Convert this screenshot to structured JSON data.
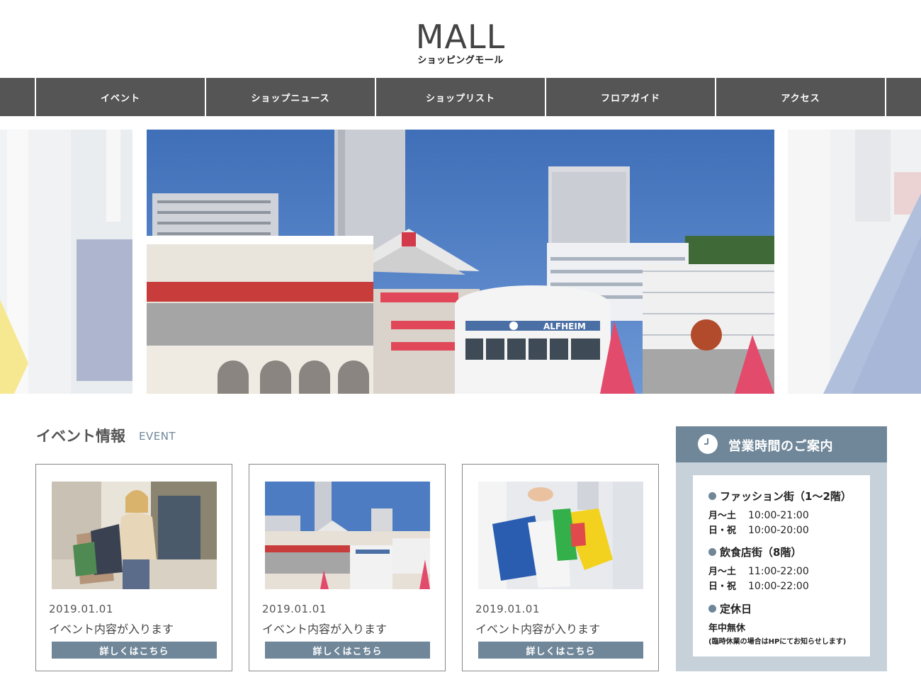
{
  "header": {
    "logo": "MALL",
    "logo_sub": "ショッピングモール"
  },
  "nav": {
    "items": [
      "イベント",
      "ショップニュース",
      "ショップリスト",
      "フロアガイド",
      "アクセス"
    ]
  },
  "slider": {
    "main_sign": "ALFHEIM"
  },
  "events": {
    "title": "イベント情報",
    "subtitle": "EVENT",
    "cards": [
      {
        "date": "2019.01.01",
        "text": "イベント内容が入ります",
        "button": "詳しくはこちら"
      },
      {
        "date": "2019.01.01",
        "text": "イベント内容が入ります",
        "button": "詳しくはこちら"
      },
      {
        "date": "2019.01.01",
        "text": "イベント内容が入ります",
        "button": "詳しくはこちら"
      }
    ]
  },
  "hours": {
    "title": "営業時間のご案内",
    "fashion": {
      "label": "ファッション街（1〜2階）",
      "row1_day": "月〜土",
      "row1_time": "10:00-21:00",
      "row2_day": "日・祝",
      "row2_time": "10:00-20:00"
    },
    "food": {
      "label": "飲食店街（8階）",
      "row1_day": "月〜土",
      "row1_time": "11:00-22:00",
      "row2_day": "日・祝",
      "row2_time": "10:00-22:00"
    },
    "holiday": {
      "label": "定休日",
      "value": "年中無休",
      "note": "(臨時休業の場合はHPにてお知らせします)"
    }
  },
  "colors": {
    "accent": "#6f8799",
    "nav_bg": "#555555",
    "hours_bg": "#c7d1da"
  }
}
